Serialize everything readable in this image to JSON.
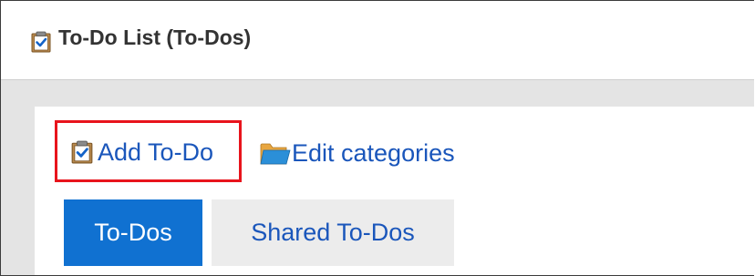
{
  "header": {
    "title": "To-Do List (To-Dos)",
    "icon": "clipboard-check-icon"
  },
  "actions": {
    "add_todo": {
      "label": "Add To-Do",
      "icon": "clipboard-check-icon",
      "highlight_color": "#e8141c"
    },
    "edit_categories": {
      "label": "Edit categories",
      "icon": "folder-icon"
    }
  },
  "tabs": [
    {
      "label": "To-Dos",
      "active": true
    },
    {
      "label": "Shared To-Dos",
      "active": false
    }
  ],
  "colors": {
    "link": "#1a56bb",
    "active_tab_bg": "#1071d1",
    "inactive_tab_bg": "#ececec",
    "band_bg": "#e4e4e4",
    "title_text": "#333333"
  }
}
